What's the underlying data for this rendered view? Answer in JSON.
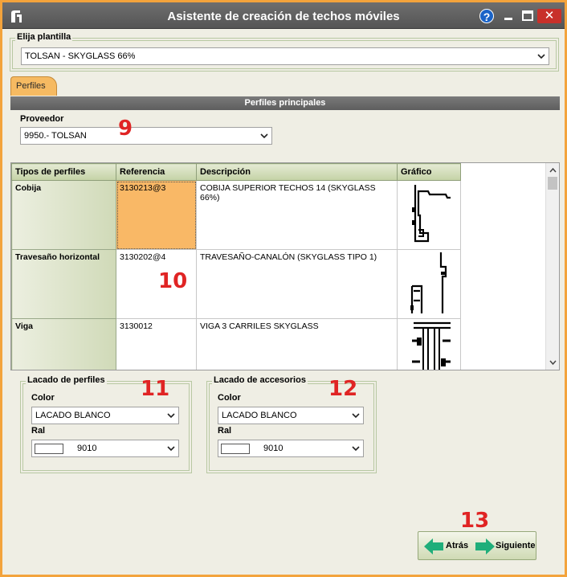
{
  "window": {
    "title": "Asistente de creación de techos móviles",
    "help_label": "?",
    "close_label": "✕"
  },
  "template": {
    "legend": "Elija plantilla",
    "value": "TOLSAN - SKYGLASS 66%"
  },
  "tab": {
    "label": "Perfiles"
  },
  "section": {
    "title": "Perfiles principales"
  },
  "provider": {
    "label": "Proveedor",
    "value": "9950.- TOLSAN"
  },
  "profiles": {
    "columns": [
      "Tipos de perfiles",
      "Referencia",
      "Descripción",
      "Gráfico"
    ],
    "rows": [
      {
        "tipo": "Cobija",
        "ref": "3130213@3",
        "desc": "COBIJA SUPERIOR TECHOS 14 (SKYGLASS 66%)",
        "selected": true
      },
      {
        "tipo": "Travesaño horizontal",
        "ref": "3130202@4",
        "desc": "TRAVESAÑO-CANALÓN (SKYGLASS TIPO 1)",
        "selected": false
      },
      {
        "tipo": "Viga",
        "ref": "3130012",
        "desc": "VIGA 3 CARRILES SKYGLASS",
        "selected": false
      }
    ]
  },
  "lacquer_profiles": {
    "legend": "Lacado de perfiles",
    "color_label": "Color",
    "color_value": "LACADO BLANCO",
    "ral_label": "Ral",
    "ral_value": "9010",
    "swatch_color": "#ffffff"
  },
  "lacquer_accessories": {
    "legend": "Lacado de accesorios",
    "color_label": "Color",
    "color_value": "LACADO BLANCO",
    "ral_label": "Ral",
    "ral_value": "9010",
    "swatch_color": "#ffffff"
  },
  "navigation": {
    "back_label": "Atrás",
    "next_label": "Siguiente",
    "arrow_color": "#1fae7a"
  },
  "annotations": [
    "9",
    "10",
    "11",
    "12",
    "13"
  ]
}
